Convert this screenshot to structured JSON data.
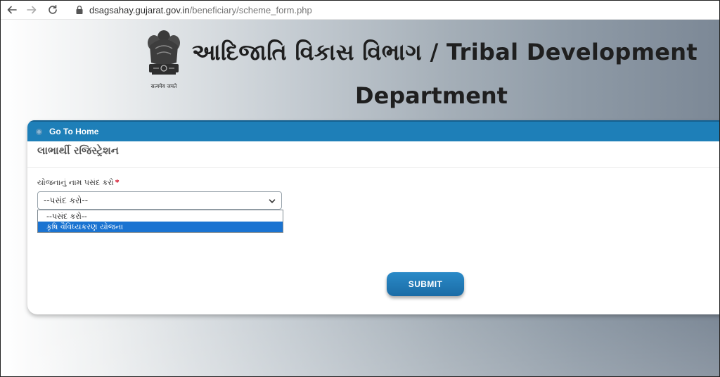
{
  "browser": {
    "url_host": "dsagsahay.gujarat.gov.in",
    "url_path": "/beneficiary/scheme_form.php"
  },
  "header": {
    "emblem_caption": "सत्यमेव जयते",
    "title_line1": "આદિજાતિ વિકાસ વિભાગ / Tribal Development",
    "title_line2": "Department"
  },
  "card": {
    "home_link": "Go To Home",
    "registration_title": "લાભાર્થી રજિસ્ટ્રેશન",
    "field_label": "યોજનાનું નામ પસંદ કરો",
    "required_mark": "*",
    "select_value": "--પસંદ કરો--",
    "dropdown_options": [
      "--પસંદ કરો--",
      "કૃષિ વૈવિધ્યકરણ યોજના"
    ],
    "highlighted_option_index": 1,
    "submit_label": "SUBMIT"
  },
  "colors": {
    "header_bar": "#1e7fb8",
    "submit_button": "#1b6ca6",
    "option_highlight": "#1a73d1",
    "required": "#d0021b"
  }
}
